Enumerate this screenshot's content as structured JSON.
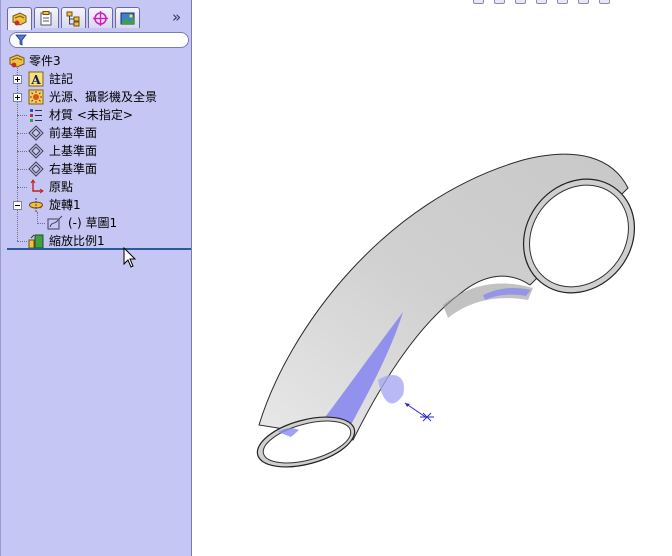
{
  "panel": {
    "tabs": [
      {
        "name": "feature-manager-tab",
        "icon": "feature-tree-icon"
      },
      {
        "name": "property-manager-tab",
        "icon": "property-manager-icon"
      },
      {
        "name": "configuration-manager-tab",
        "icon": "configuration-manager-icon"
      },
      {
        "name": "dimxpert-manager-tab",
        "icon": "dimxpert-icon"
      },
      {
        "name": "display-manager-tab",
        "icon": "display-manager-icon"
      }
    ],
    "more_glyph": "»",
    "filter_icon": "filter-icon"
  },
  "tree": {
    "root": "零件3",
    "annotations": "註記",
    "lights": "光源、攝影機及全景",
    "material": "材質 <未指定>",
    "front_plane": "前基準面",
    "top_plane": "上基準面",
    "right_plane": "右基準面",
    "origin": "原點",
    "revolve": "旋轉1",
    "sketch": "(-) 草圖1",
    "scale": "縮放比例1"
  },
  "colors": {
    "panel_bg": "#c6c6f5",
    "rollback_bar": "#2a5a9a",
    "model_gray": "#d6d6d6",
    "highlight": "#8888ee"
  }
}
